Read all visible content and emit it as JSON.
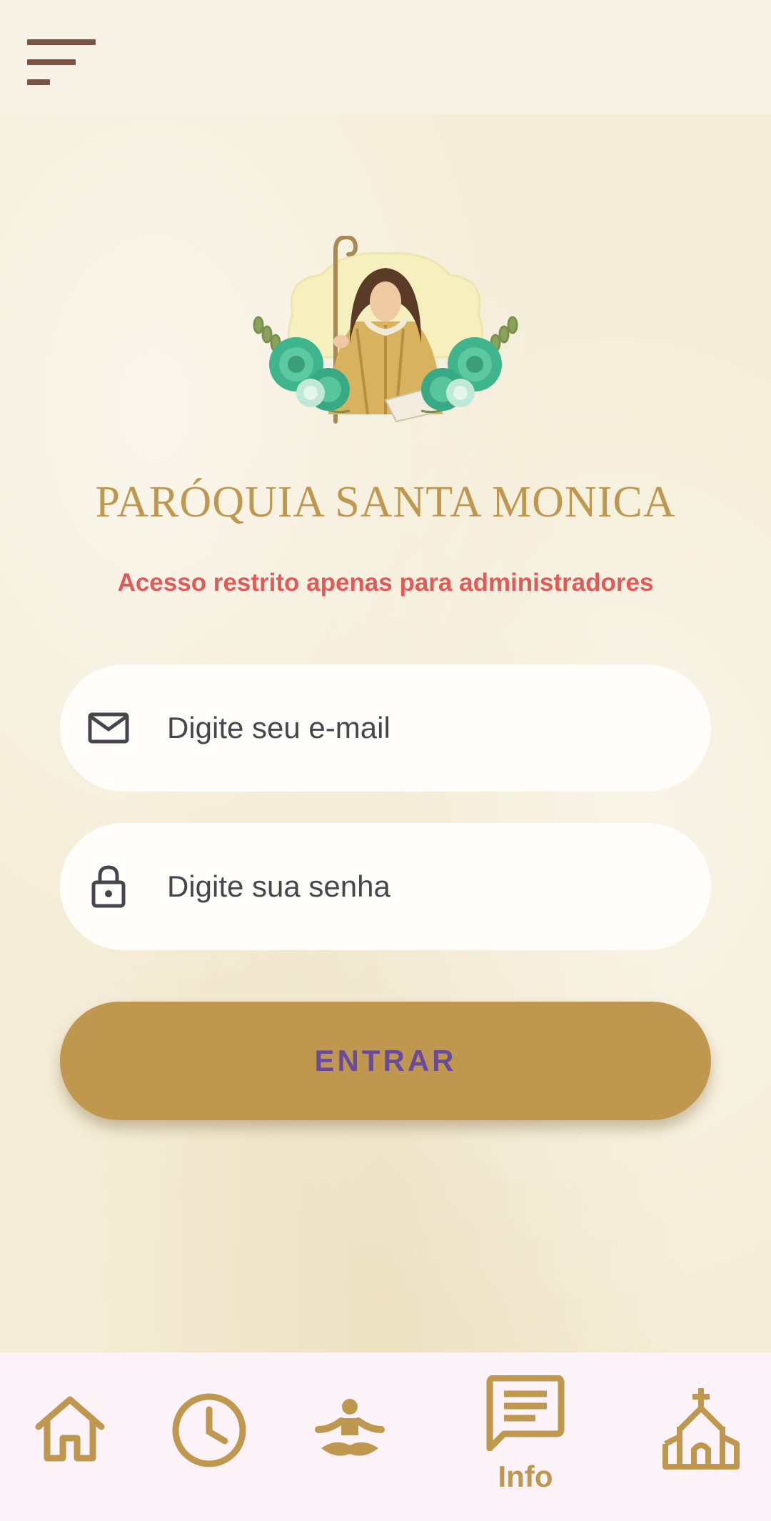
{
  "app": {
    "title": "PARÓQUIA SANTA MONICA",
    "subtitle": "Acesso restrito apenas para administradores"
  },
  "header": {
    "menu_icon": "menu-icon"
  },
  "form": {
    "email": {
      "icon": "mail-icon",
      "placeholder": "Digite seu e-mail",
      "value": ""
    },
    "password": {
      "icon": "lock-icon",
      "placeholder": "Digite sua senha",
      "value": ""
    },
    "submit_label": "ENTRAR"
  },
  "nav": {
    "items": [
      {
        "icon": "home-icon",
        "label": ""
      },
      {
        "icon": "clock-icon",
        "label": ""
      },
      {
        "icon": "meditation-icon",
        "label": ""
      },
      {
        "icon": "message-icon",
        "label": "Info",
        "active": true
      },
      {
        "icon": "church-icon",
        "label": ""
      }
    ]
  },
  "colors": {
    "accent": "#bf974f",
    "title": "#bf9850",
    "warning": "#e05a5a",
    "button_text": "#6a4a9c",
    "menu": "#7b5246",
    "nav_bg": "#fbf3f7"
  }
}
